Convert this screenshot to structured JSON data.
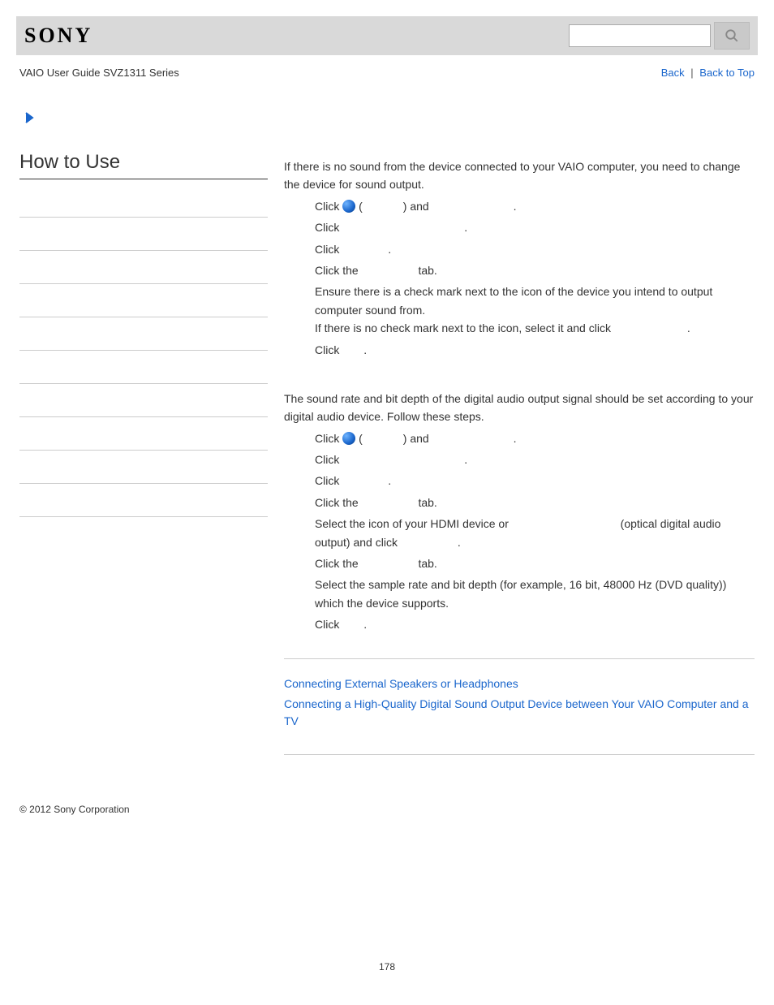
{
  "header": {
    "logo_text": "SONY",
    "search_placeholder": ""
  },
  "subheader": {
    "breadcrumb": "VAIO User Guide SVZ1311 Series",
    "back_label": "Back",
    "top_label": "Back to Top"
  },
  "sidebar": {
    "title": "How to Use",
    "item_count": 10
  },
  "main": {
    "intro1": "If there is no sound from the device connected to your VAIO computer, you need to change the device for sound output.",
    "s1_1a": "Click ",
    "s1_1b": " (",
    "s1_1c": ") and ",
    "s1_1d": ".",
    "s1_2a": "Click ",
    "s1_2b": ".",
    "s1_3a": "Click ",
    "s1_3b": ".",
    "s1_4a": "Click the ",
    "s1_4b": " tab.",
    "s1_5a": "Ensure there is a check mark next to the icon of the device you intend to output computer sound from.",
    "s1_5b": "If there is no check mark next to the icon, select it and click ",
    "s1_5c": ".",
    "s1_6a": "Click ",
    "s1_6b": ".",
    "intro2": "The sound rate and bit depth of the digital audio output signal should be set according to your digital audio device. Follow these steps.",
    "s2_1a": "Click ",
    "s2_1b": " (",
    "s2_1c": ") and ",
    "s2_1d": ".",
    "s2_2a": "Click ",
    "s2_2b": ".",
    "s2_3a": "Click ",
    "s2_3b": ".",
    "s2_4a": "Click the ",
    "s2_4b": " tab.",
    "s2_5a": "Select the icon of your HDMI device or ",
    "s2_5b": " (optical digital audio output) and click ",
    "s2_5c": ".",
    "s2_6a": "Click the ",
    "s2_6b": " tab.",
    "s2_7": "Select the sample rate and bit depth (for example, 16 bit, 48000 Hz (DVD quality)) which the device supports.",
    "s2_8a": "Click ",
    "s2_8b": "."
  },
  "related": {
    "link1": "Connecting External Speakers or Headphones",
    "link2": "Connecting a High-Quality Digital Sound Output Device between Your VAIO Computer and a TV"
  },
  "footer": "© 2012 Sony Corporation",
  "page_number": "178"
}
